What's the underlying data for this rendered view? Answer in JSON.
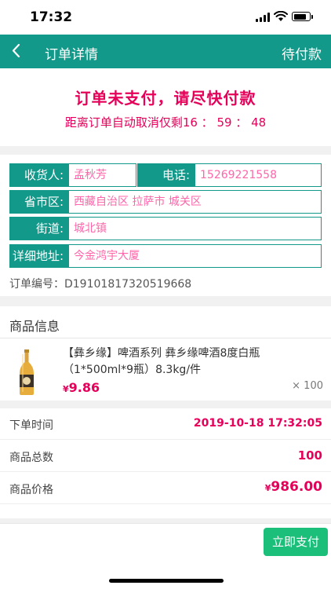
{
  "status_bar": {
    "time": "17:32"
  },
  "header": {
    "title": "订单详情",
    "status": "待付款"
  },
  "notice": {
    "title": "订单未支付，请尽快付款",
    "countdown": "距离订单自动取消仅剩16 ： 59 ： 48"
  },
  "address": {
    "receiver_label": "收货人:",
    "receiver_value": "孟秋芳",
    "phone_label": "电话:",
    "phone_value": "15269221558",
    "region_label": "省市区:",
    "region_value": "西藏自治区 拉萨市 城关区",
    "street_label": "街道:",
    "street_value": "城北镇",
    "detail_label": "详细地址:",
    "detail_value": "今金鸿宇大厦",
    "order_no": "订单编号：D19101817320519668"
  },
  "goods": {
    "header": "商品信息",
    "items": [
      {
        "name": "【彝乡缘】啤酒系列 彝乡缘啤酒8度白瓶（1*500ml*9瓶）8.3kg/件",
        "price_symbol": "¥",
        "price": "9.86",
        "quantity": "× 100"
      }
    ]
  },
  "summary": {
    "order_time_label": "下单时间",
    "order_time": "2019-10-18 17:32:05",
    "total_count_label": "商品总数",
    "total_count": "100",
    "total_price_label": "商品价格",
    "price_symbol": "¥",
    "total_price": "986.00"
  },
  "actions": {
    "pay_label": "立即支付"
  },
  "colors": {
    "primary": "#13998a",
    "accent": "#e5005a",
    "value_text": "#ff66aa",
    "pay_button": "#1bbf7a",
    "section_gap": "#f1f1f1"
  },
  "icons": {
    "back": "chevron-left-icon",
    "signal": "signal-icon",
    "wifi": "wifi-icon",
    "battery": "battery-icon"
  }
}
